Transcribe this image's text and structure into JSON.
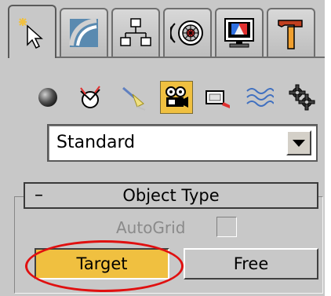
{
  "command_panel": {
    "tabs": [
      {
        "name": "create",
        "icon": "create-arrow-icon",
        "active": true
      },
      {
        "name": "modify",
        "icon": "modify-curve-icon",
        "active": false
      },
      {
        "name": "hierarchy",
        "icon": "hierarchy-icon",
        "active": false
      },
      {
        "name": "motion",
        "icon": "motion-wheel-icon",
        "active": false
      },
      {
        "name": "display",
        "icon": "display-monitor-icon",
        "active": false
      },
      {
        "name": "utilities",
        "icon": "hammer-icon",
        "active": false
      }
    ],
    "subcategories": [
      {
        "name": "geometry",
        "icon": "sphere-icon",
        "active": false
      },
      {
        "name": "shapes",
        "icon": "shapes-icon",
        "active": false
      },
      {
        "name": "lights",
        "icon": "light-icon",
        "active": false
      },
      {
        "name": "cameras",
        "icon": "camera-icon",
        "active": true
      },
      {
        "name": "helpers",
        "icon": "helper-tape-icon",
        "active": false
      },
      {
        "name": "space-warps",
        "icon": "waves-icon",
        "active": false
      },
      {
        "name": "systems",
        "icon": "gears-icon",
        "active": false
      }
    ],
    "type_dropdown": {
      "value": "Standard"
    },
    "rollout": {
      "collapse_symbol": "–",
      "title": "Object Type",
      "autogrid_label": "AutoGrid",
      "autogrid_checked": false,
      "buttons": {
        "target": "Target",
        "free": "Free"
      }
    },
    "colors": {
      "panel_bg": "#c8c8c8",
      "active_yellow": "#f0c040",
      "highlight_red": "#e01010"
    }
  }
}
